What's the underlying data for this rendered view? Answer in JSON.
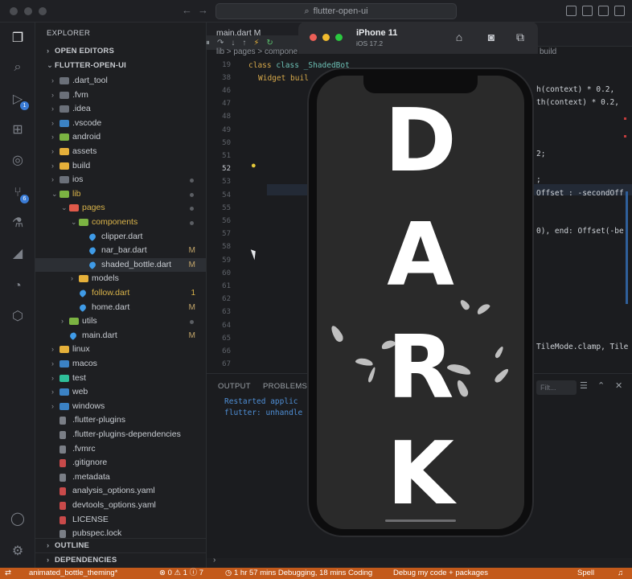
{
  "titlebar": {
    "search_text": "flutter-open-ui"
  },
  "sidebar": {
    "title": "EXPLORER",
    "open_editors": "OPEN EDITORS",
    "project": "FLUTTER-OPEN-UI",
    "outline": "OUTLINE",
    "dependencies": "DEPENDENCIES",
    "tree": [
      {
        "label": ".dart_tool",
        "type": "folder",
        "color": "#6b7079"
      },
      {
        "label": ".fvm",
        "type": "folder",
        "color": "#6b7079"
      },
      {
        "label": ".idea",
        "type": "folder",
        "color": "#6b7079"
      },
      {
        "label": ".vscode",
        "type": "folder",
        "color": "#3b82c4"
      },
      {
        "label": "android",
        "type": "folder",
        "color": "#7bb342"
      },
      {
        "label": "assets",
        "type": "folder",
        "color": "#e5b03a"
      },
      {
        "label": "build",
        "type": "folder",
        "color": "#e5b03a"
      },
      {
        "label": "ios",
        "type": "folder",
        "color": "#6b7079"
      },
      {
        "label": "lib",
        "type": "folder",
        "color": "#7bb342"
      },
      {
        "label": "pages",
        "type": "folder",
        "color": "#e05a4a"
      },
      {
        "label": "components",
        "type": "folder",
        "color": "#7bb342"
      },
      {
        "label": "clipper.dart",
        "type": "dart"
      },
      {
        "label": "nar_bar.dart",
        "type": "dart",
        "badge": "M"
      },
      {
        "label": "shaded_bottle.dart",
        "type": "dart",
        "badge": "M"
      },
      {
        "label": "models",
        "type": "folder",
        "color": "#e5b03a"
      },
      {
        "label": "follow.dart",
        "type": "dart",
        "badge": "1"
      },
      {
        "label": "home.dart",
        "type": "dart",
        "badge": "M"
      },
      {
        "label": "utils",
        "type": "folder",
        "color": "#7bb342"
      },
      {
        "label": "main.dart",
        "type": "dart",
        "badge": "M"
      },
      {
        "label": "linux",
        "type": "folder",
        "color": "#e5b03a"
      },
      {
        "label": "macos",
        "type": "folder",
        "color": "#3b82c4"
      },
      {
        "label": "test",
        "type": "folder",
        "color": "#2fbf9a"
      },
      {
        "label": "web",
        "type": "folder",
        "color": "#3b82c4"
      },
      {
        "label": "windows",
        "type": "folder",
        "color": "#3b82c4"
      },
      {
        "label": ".flutter-plugins",
        "type": "file"
      },
      {
        "label": ".flutter-plugins-dependencies",
        "type": "file"
      },
      {
        "label": ".fvmrc",
        "type": "file"
      },
      {
        "label": ".gitignore",
        "type": "file"
      },
      {
        "label": ".metadata",
        "type": "file"
      },
      {
        "label": "analysis_options.yaml",
        "type": "file"
      },
      {
        "label": "devtools_options.yaml",
        "type": "file"
      },
      {
        "label": "LICENSE",
        "type": "file"
      },
      {
        "label": "pubspec.lock",
        "type": "file"
      }
    ]
  },
  "editor": {
    "tab": "main.dart M",
    "breadcrumb": "lib > pages > compone",
    "breadcrumb_right": "build",
    "lines": [
      {
        "num": "19",
        "text": "class _ShadedBot"
      },
      {
        "num": "38",
        "text": "Widget buil"
      },
      {
        "num": "46",
        "text": ""
      },
      {
        "num": "47",
        "text": ""
      },
      {
        "num": "48",
        "text": ""
      },
      {
        "num": "49",
        "text": ""
      },
      {
        "num": "50",
        "text": ""
      },
      {
        "num": "51",
        "text": ""
      },
      {
        "num": "52",
        "text": ""
      },
      {
        "num": "53",
        "text": ""
      },
      {
        "num": "54",
        "text": ""
      },
      {
        "num": "55",
        "text": ""
      },
      {
        "num": "56",
        "text": ""
      },
      {
        "num": "57",
        "text": ""
      },
      {
        "num": "58",
        "text": ""
      },
      {
        "num": "59",
        "text": ""
      },
      {
        "num": "60",
        "text": ""
      },
      {
        "num": "61",
        "text": ""
      },
      {
        "num": "62",
        "text": ""
      },
      {
        "num": "63",
        "text": ""
      },
      {
        "num": "64",
        "text": ""
      },
      {
        "num": "65",
        "text": ""
      },
      {
        "num": "66",
        "text": ""
      },
      {
        "num": "67",
        "text": ""
      }
    ],
    "right_code": [
      {
        "text": "h(context) * 0.2,"
      },
      {
        "text": "th(context) * 0.2,"
      },
      {
        "text": "2;"
      },
      {
        "text": ";"
      },
      {
        "text": "Offset : -secondOff"
      },
      {
        "text": "0), end: Offset(-be"
      },
      {
        "text": "TileMode.clamp, Tile"
      }
    ]
  },
  "panel": {
    "tab_output": "OUTPUT",
    "tab_problems": "PROBLEMS",
    "line1": "Restarted applic",
    "line2": "flutter: unhandle",
    "filter": "Filt..."
  },
  "simulator": {
    "device": "iPhone 11",
    "os": "iOS 17.2",
    "letters": [
      "D",
      "A",
      "R",
      "K"
    ]
  },
  "statusbar": {
    "branch": "animated_bottle_theming*",
    "problems": "⊗ 0 ⚠ 1 ⓘ 7",
    "debug_time": "1 hr 57 mins Debugging, 18 mins Coding",
    "debug_mode": "Debug my code + packages",
    "spell": "Spell"
  }
}
